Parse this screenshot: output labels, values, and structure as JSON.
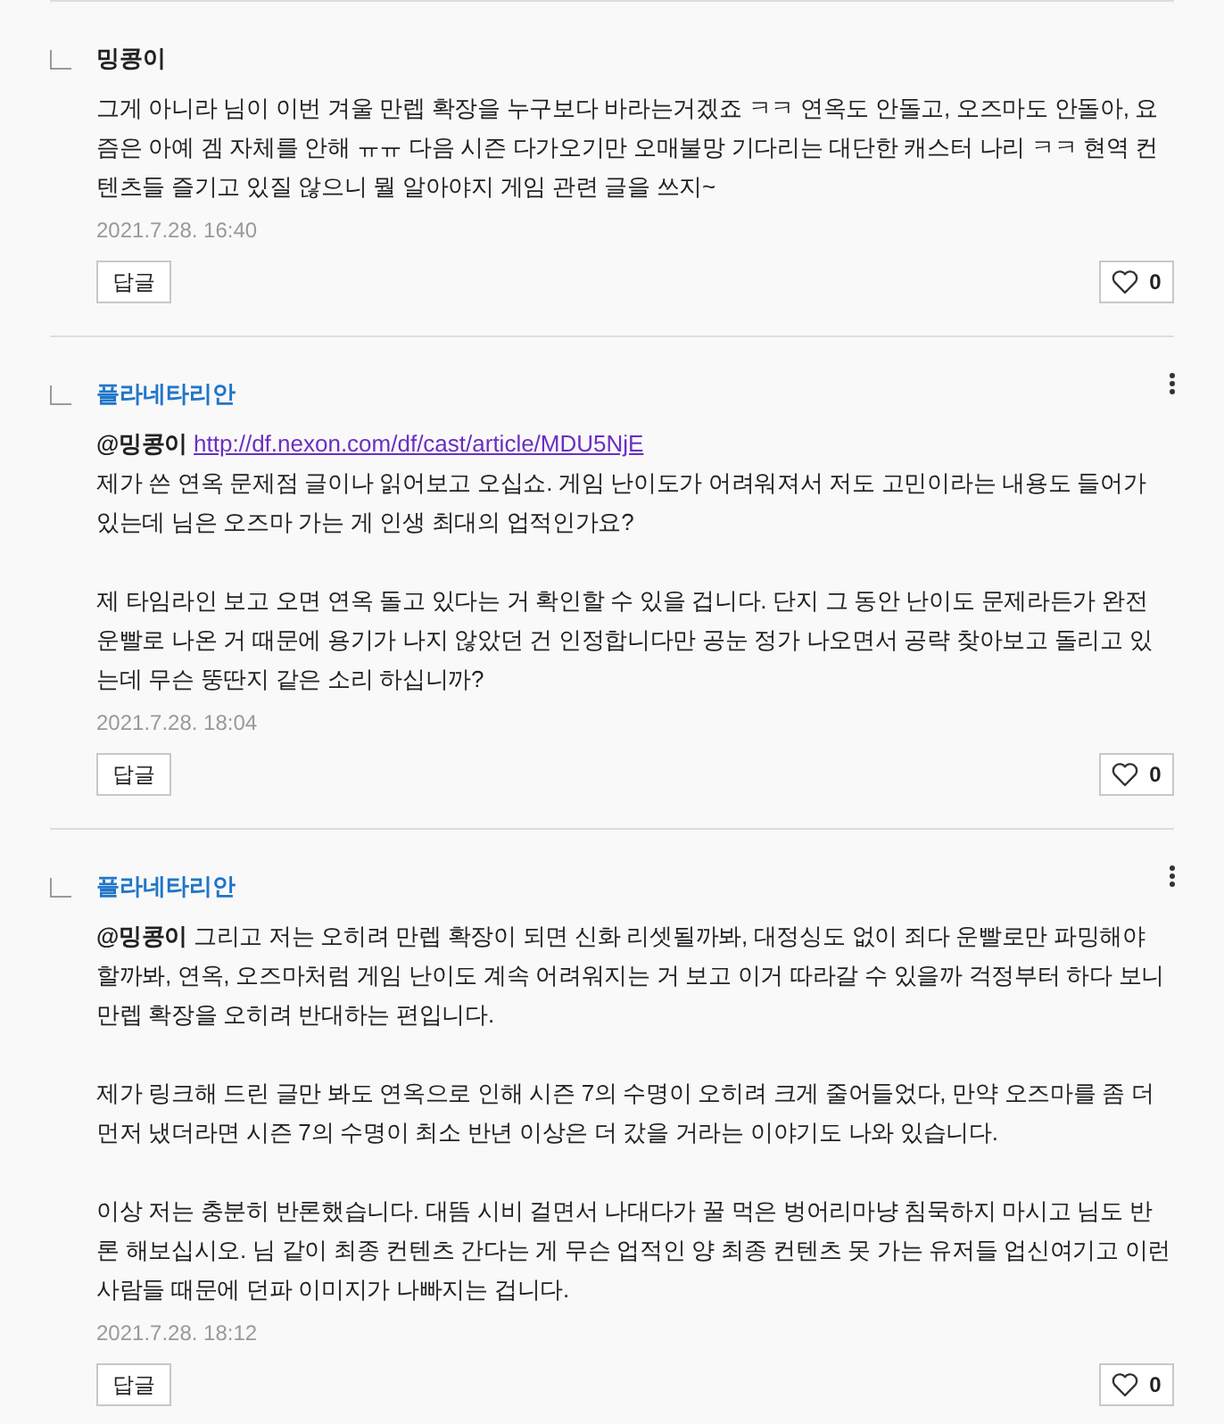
{
  "comments": [
    {
      "author": {
        "name": "밍콩이",
        "color": "#222222"
      },
      "more_menu": false,
      "paragraphs": [
        [
          {
            "text": "그게 아니라 님이 이번 겨울 만렙 확장을 누구보다 바라는거겠죠 ㅋㅋ 연옥도 안돌고, 오즈마도 안돌아, 요즘은 아예 겜 자체를 안해 ㅠㅠ 다음 시즌 다가오기만 오매불망 기다리는 대단한 캐스터 나리 ㅋㅋ 현역 컨텐츠들 즐기고 있질 않으니 뭘 알아야지 게임 관련 글을 쓰지~"
          }
        ]
      ],
      "date": "2021.7.28. 16:40",
      "reply_label": "답글",
      "liked": false,
      "like_count": "0"
    },
    {
      "author": {
        "name": "플라네타리안",
        "color": "#2076c9"
      },
      "more_menu": true,
      "paragraphs": [
        [
          {
            "text": "**@밍콩이**",
            "link": "http://df.nexon.com/df/cast/article/MDU5NjE"
          },
          {
            "text": "제가 쓴 연옥 문제점 글이나 읽어보고 오십쇼. 게임 난이도가 어려워져서 저도 고민이라는 내용도 들어가 있는데 님은 오즈마 가는 게 인생 최대의 업적인가요?"
          }
        ],
        [
          {
            "text": "제 타임라인 보고 오면 연옥 돌고 있다는 거 확인할 수 있을 겁니다. 단지 그 동안 난이도 문제라든가 완전 운빨로 나온 거 때문에 용기가 나지 않았던 건 인정합니다만 공눈 정가 나오면서 공략 찾아보고 돌리고 있는데 무슨 뚱딴지 같은 소리 하십니까?"
          }
        ]
      ],
      "date": "2021.7.28. 18:04",
      "reply_label": "답글",
      "liked": false,
      "like_count": "0"
    },
    {
      "author": {
        "name": "플라네타리안",
        "color": "#2076c9"
      },
      "more_menu": true,
      "paragraphs": [
        [
          {
            "text": "**@밍콩이** 그리고 저는 오히려 만렙 확장이 되면 신화 리셋될까봐, 대정싱도 없이 죄다 운빨로만 파밍해야 할까봐, 연옥, 오즈마처럼 게임 난이도 계속 어려워지는 거 보고 이거 따라갈 수 있을까 걱정부터 하다 보니 만렙 확장을 오히려 반대하는 편입니다."
          }
        ],
        [
          {
            "text": "제가 링크해 드린 글만 봐도 연옥으로 인해 시즌 7의 수명이 오히려 크게 줄어들었다, 만약 오즈마를 좀 더 먼저 냈더라면 시즌 7의 수명이 최소 반년 이상은 더 갔을 거라는 이야기도 나와 있습니다."
          }
        ],
        [
          {
            "text": "이상 저는 충분히 반론했습니다. 대뜸 시비 걸면서 나대다가 꿀 먹은 벙어리마냥 침묵하지 마시고 님도 반론 해보십시오. 님 같이 최종 컨텐츠 간다는 게 무슨 업적인 양 최종 컨텐츠 못 가는 유저들 업신여기고 이런 사람들 때문에 던파 이미지가 나빠지는 겁니다."
          }
        ]
      ],
      "date": "2021.7.28. 18:12",
      "reply_label": "답글",
      "liked": false,
      "like_count": "0"
    }
  ]
}
